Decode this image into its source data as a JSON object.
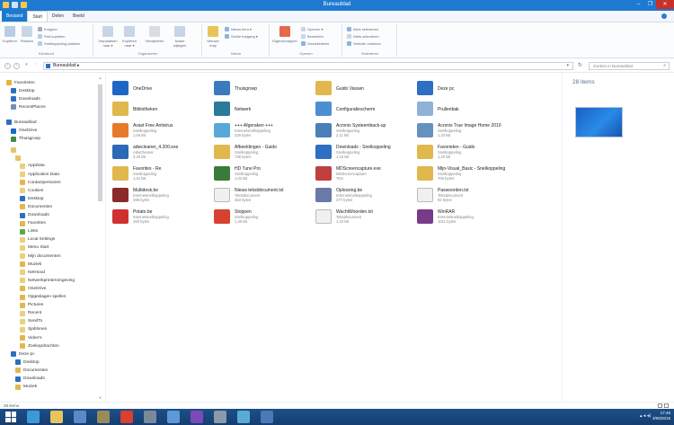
{
  "window": {
    "title": "Bureaublad"
  },
  "tabs": [
    "Bestand",
    "Start",
    "Delen",
    "Beeld"
  ],
  "ribbon": {
    "groups": [
      "Klembord",
      "Organiseren",
      "Nieuw",
      "Openen",
      "Selecteren"
    ],
    "big_buttons": [
      {
        "label": "Kopiëren",
        "icon": "copy-icon"
      },
      {
        "label": "Plakken",
        "icon": "paste-icon"
      },
      {
        "label": "Verplaatsen naar ▾",
        "icon": "move-to-icon"
      },
      {
        "label": "Kopiëren naar ▾",
        "icon": "copy-to-icon"
      },
      {
        "label": "Verwijderen",
        "icon": "delete-icon"
      },
      {
        "label": "Naam wijzigen",
        "icon": "rename-icon"
      },
      {
        "label": "Nieuwe map",
        "icon": "new-folder-icon"
      },
      {
        "label": "Eigenschappen",
        "icon": "properties-icon"
      }
    ],
    "small_buttons": [
      {
        "label": "Knippen",
        "icon": "cut-icon"
      },
      {
        "label": "Pad kopiëren",
        "icon": "copy-path-icon"
      },
      {
        "label": "Snelkoppeling plakken",
        "icon": "paste-shortcut-icon"
      },
      {
        "label": "Nieuw item ▾",
        "icon": "new-item-icon"
      },
      {
        "label": "Snelle toegang ▾",
        "icon": "easy-access-icon"
      },
      {
        "label": "Openen ▾",
        "icon": "open-icon"
      },
      {
        "label": "Bewerken",
        "icon": "edit-icon"
      },
      {
        "label": "Geschiedenis",
        "icon": "history-icon"
      },
      {
        "label": "Alles selecteren",
        "icon": "select-all-icon"
      },
      {
        "label": "Niets selecteren",
        "icon": "select-none-icon"
      },
      {
        "label": "Selectie omkeren",
        "icon": "invert-selection-icon"
      }
    ]
  },
  "address": {
    "path": "Bureaublad ▸",
    "search_placeholder": "Zoeken in Bureaublad"
  },
  "navpane": {
    "items": [
      {
        "label": "Favorieten",
        "color": "#e8b23a"
      },
      {
        "label": "Desktop",
        "color": "#2d6fc2"
      },
      {
        "label": "Downloads",
        "color": "#2d6fc2"
      },
      {
        "label": "RecentPlaces",
        "color": "#6f8fb8"
      },
      {
        "label": "Bureaublad",
        "color": "#2d6fc2"
      },
      {
        "label": "OneDrive",
        "color": "#1c67c6"
      },
      {
        "label": "Thuisgroep",
        "color": "#3c8c4c"
      },
      {
        "label": "",
        "color": "#e3c46a"
      },
      {
        "label": "",
        "color": "#e3c46a"
      },
      {
        "label": "AppData",
        "color": "#e9cf7f"
      },
      {
        "label": "Application Data",
        "color": "#e9cf7f"
      },
      {
        "label": "Contactpersonen",
        "color": "#e0b84e"
      },
      {
        "label": "Cookies",
        "color": "#e9cf7f"
      },
      {
        "label": "Desktop",
        "color": "#2d6fc2"
      },
      {
        "label": "Documenten",
        "color": "#e0b84e"
      },
      {
        "label": "Downloads",
        "color": "#2d6fc2"
      },
      {
        "label": "Favorites",
        "color": "#e0b84e"
      },
      {
        "label": "Links",
        "color": "#5aa84e"
      },
      {
        "label": "Local Settings",
        "color": "#e9cf7f"
      },
      {
        "label": "Menu Start",
        "color": "#e9cf7f"
      },
      {
        "label": "Mijn documenten",
        "color": "#e9cf7f"
      },
      {
        "label": "Muziek",
        "color": "#e0b84e"
      },
      {
        "label": "NetHood",
        "color": "#e9cf7f"
      },
      {
        "label": "Netwerkprinteromgeving",
        "color": "#e9cf7f"
      },
      {
        "label": "OneDrive",
        "color": "#e0b84e"
      },
      {
        "label": "Opgeslagen spellen",
        "color": "#e0b84e"
      },
      {
        "label": "Pictures",
        "color": "#e0b84e"
      },
      {
        "label": "Recent",
        "color": "#e9cf7f"
      },
      {
        "label": "SendTo",
        "color": "#e9cf7f"
      },
      {
        "label": "Sjablonen",
        "color": "#e9cf7f"
      },
      {
        "label": "Video's",
        "color": "#e0b84e"
      },
      {
        "label": "Zoekopdrachten",
        "color": "#e0b84e"
      },
      {
        "label": "Deze pc",
        "color": "#2d6fc2"
      },
      {
        "label": "Desktop",
        "color": "#2d6fc2"
      },
      {
        "label": "Documenten",
        "color": "#e0b84e"
      },
      {
        "label": "Downloads",
        "color": "#2d6fc2"
      },
      {
        "label": "Muziek",
        "color": "#e0b84e"
      }
    ]
  },
  "files": [
    {
      "name": "OneDrive",
      "l2": "",
      "l3": "",
      "icon": "onedrive-icon",
      "color": "#1c67c6"
    },
    {
      "name": "Thuisgroep",
      "l2": "",
      "l3": "",
      "icon": "homegroup-icon",
      "color": "#3a7bbf"
    },
    {
      "name": "Guido Vassen",
      "l2": "",
      "l3": "",
      "icon": "user-folder-icon",
      "color": "#e0b84e"
    },
    {
      "name": "Deze pc",
      "l2": "",
      "l3": "",
      "icon": "computer-icon",
      "color": "#2d6fc2"
    },
    {
      "name": "Bibliotheken",
      "l2": "",
      "l3": "",
      "icon": "libraries-icon",
      "color": "#e0b84e"
    },
    {
      "name": "Netwerk",
      "l2": "",
      "l3": "",
      "icon": "network-icon",
      "color": "#2a7a9a"
    },
    {
      "name": "Configuratiescherm",
      "l2": "",
      "l3": "",
      "icon": "control-panel-icon",
      "color": "#4c8fd0"
    },
    {
      "name": "Prullenbak",
      "l2": "",
      "l3": "",
      "icon": "recycle-bin-icon",
      "color": "#8fb2d6"
    },
    {
      "name": "Avast Free Antivirus",
      "l2": "Snelkoppeling",
      "l3": "1,06 kB",
      "icon": "avast-icon",
      "color": "#e8782a"
    },
    {
      "name": "+++ Afgeraken +++",
      "l2": "Internetsnelkoppeling",
      "l3": "229 bytes",
      "icon": "internet-shortcut-icon",
      "color": "#58a8d8"
    },
    {
      "name": "Acronis Systeemback-up",
      "l2": "Snelkoppeling",
      "l3": "2,11 kB",
      "icon": "acronis-icon",
      "color": "#4a7fb8"
    },
    {
      "name": "Acronis True Image Home 2010",
      "l2": "Snelkoppeling",
      "l3": "1,33 kB",
      "icon": "acronis-icon",
      "color": "#6690c0"
    },
    {
      "name": "adwcleaner_4.200.exe",
      "l2": "AdwCleaner",
      "l3": "4,26 kB",
      "icon": "adwcleaner-icon",
      "color": "#2a6ab8"
    },
    {
      "name": "Afbeeldingen - Guido",
      "l2": "Snelkoppeling",
      "l3": "738 bytes",
      "icon": "folder-shortcut-icon",
      "color": "#e0b84e"
    },
    {
      "name": "Downloads - Snelkoppeling",
      "l2": "Snelkoppeling",
      "l3": "1,18 kB",
      "icon": "folder-shortcut-icon",
      "color": "#2d6fc2"
    },
    {
      "name": "Favorieten - Guido",
      "l2": "Snelkoppeling",
      "l3": "1,20 kB",
      "icon": "folder-shortcut-icon",
      "color": "#e0b84e"
    },
    {
      "name": "Favorites - Re",
      "l2": "Snelkoppeling",
      "l3": "1,01 kB",
      "icon": "folder-shortcut-icon",
      "color": "#e0b84e"
    },
    {
      "name": "HD Tune Pro",
      "l2": "Snelkoppeling",
      "l3": "1,02 kB",
      "icon": "hdtune-icon",
      "color": "#3a7a3a"
    },
    {
      "name": "MDScreencapture.exe",
      "l2": "MDScreencapture",
      "l3": "?KS",
      "icon": "screencapture-icon",
      "color": "#c04040"
    },
    {
      "name": "Mijn-Visual_Basic - Snelkoppeling",
      "l2": "Snelkoppeling",
      "l3": "708 bytes",
      "icon": "folder-shortcut-icon",
      "color": "#e0b84e"
    },
    {
      "name": "Multidesk.be",
      "l2": "Internetsnelkoppeling",
      "l3": "288 bytes",
      "icon": "multidesk-icon",
      "color": "#8a2a2a"
    },
    {
      "name": "Nieuw tekstdocument.txt",
      "l2": "Tekstdocument",
      "l3": "463 bytes",
      "icon": "text-document-icon",
      "color": "#f0f0f0"
    },
    {
      "name": "Oplossing.be",
      "l2": "Internetsnelkoppeling",
      "l3": "377 bytes",
      "icon": "internet-shortcut-icon",
      "color": "#6a7aa8"
    },
    {
      "name": "Paswoorden.txt",
      "l2": "Tekstdocument",
      "l3": "92 bytes",
      "icon": "text-document-icon",
      "color": "#f0f0f0"
    },
    {
      "name": "Potato.be",
      "l2": "Internetsnelkoppeling",
      "l3": "400 bytes",
      "icon": "potato-icon",
      "color": "#d03030"
    },
    {
      "name": "Stoppen",
      "l2": "Snelkoppeling",
      "l3": "1,45 kB",
      "icon": "power-icon",
      "color": "#d84030"
    },
    {
      "name": "WachtWoorden.txt",
      "l2": "Tekstdocument",
      "l3": "1,34 kB",
      "icon": "text-document-icon",
      "color": "#f0f0f0"
    },
    {
      "name": "WinRAR",
      "l2": "Internetsnelkoppeling",
      "l3": "1011 bytes",
      "icon": "winrar-icon",
      "color": "#7a3a8a"
    }
  ],
  "preview": {
    "count": "28 items"
  },
  "statusbar": {
    "text": "28 items"
  },
  "taskbar": {
    "apps": [
      {
        "icon": "internet-explorer-icon",
        "color": "#3a9ad8"
      },
      {
        "icon": "file-explorer-icon",
        "color": "#e8c45a"
      },
      {
        "icon": "monitor-icon",
        "color": "#5a8ac8"
      },
      {
        "icon": "toolbox-icon",
        "color": "#9a8a5a"
      },
      {
        "icon": "opera-icon",
        "color": "#d84030"
      },
      {
        "icon": "disk-icon",
        "color": "#7a8a9a"
      },
      {
        "icon": "screen-icon",
        "color": "#5a9ad8"
      },
      {
        "icon": "visual-studio-icon",
        "color": "#7a4ab8"
      },
      {
        "icon": "tool-icon",
        "color": "#8a9aa8"
      },
      {
        "icon": "pen-icon",
        "color": "#5aaad8"
      },
      {
        "icon": "window-icon",
        "color": "#4a7ab8"
      }
    ],
    "tray": "▴ ◂ ◂)",
    "time": "17:48",
    "date": "3/06/2015"
  }
}
